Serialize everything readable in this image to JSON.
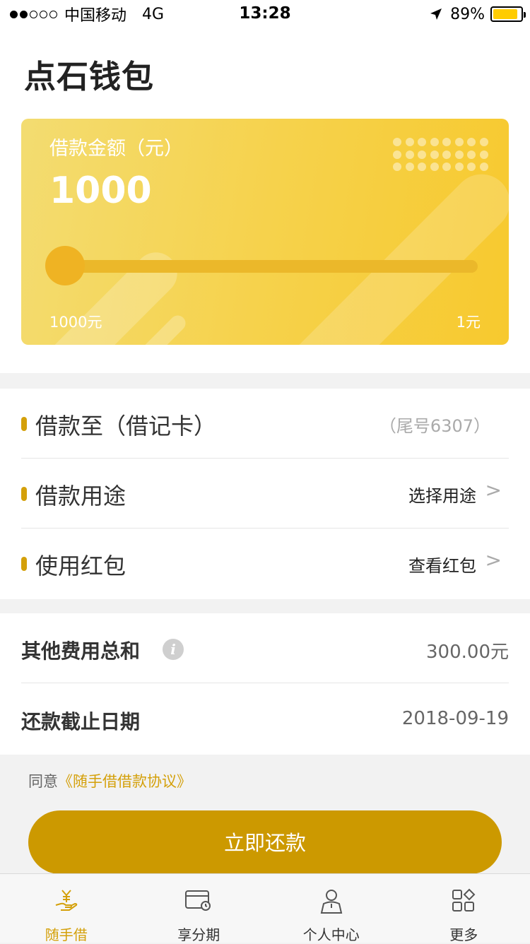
{
  "status_bar": {
    "carrier": "中国移动",
    "network": "4G",
    "time": "13:28",
    "battery": "89%",
    "battery_level": 0.89,
    "battery_color": "#ffcc00"
  },
  "page_title": "点石钱包",
  "loan_card": {
    "label": "借款金额（元）",
    "amount": "1000",
    "slider_min_label": "1000元",
    "slider_max_label": "1元",
    "slider_value_fraction": 0.0
  },
  "loan_options": [
    {
      "label": "借款至（借记卡）",
      "value": "（尾号6307）",
      "has_arrow": false
    },
    {
      "label": "借款用途",
      "value": "选择用途",
      "has_arrow": true
    },
    {
      "label": "使用红包",
      "value": "查看红包",
      "has_arrow": true
    }
  ],
  "fees": [
    {
      "label": "其他费用总和",
      "value": "300.00元",
      "has_info": true
    },
    {
      "label": "还款截止日期",
      "value": "2018-09-19",
      "has_info": false
    }
  ],
  "agreement": {
    "prefix": "同意",
    "link": "《随手借借款协议》"
  },
  "primary_button": "立即还款",
  "tabs": [
    {
      "label": "随手借",
      "icon": "hand-yen-icon",
      "active": true
    },
    {
      "label": "享分期",
      "icon": "card-clock-icon",
      "active": false
    },
    {
      "label": "个人中心",
      "icon": "user-icon",
      "active": false
    },
    {
      "label": "更多",
      "icon": "grid-icon",
      "active": false
    }
  ],
  "colors": {
    "accent": "#d4a00a",
    "button": "#cc9900",
    "card_gradient_start": "#f3dc71",
    "card_gradient_end": "#f7c92e"
  }
}
